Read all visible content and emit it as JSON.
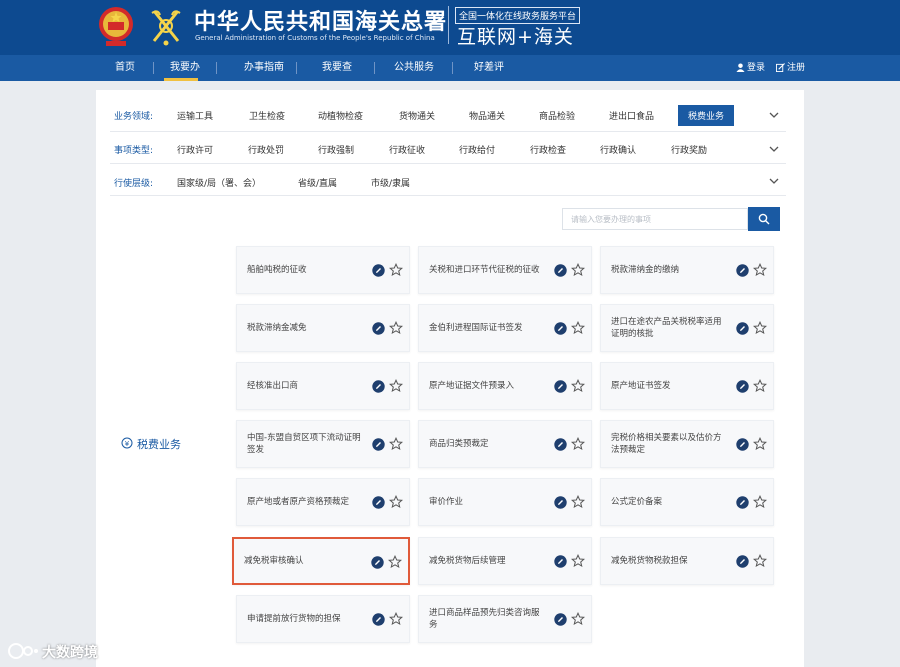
{
  "header": {
    "title": "中华人民共和国海关总署",
    "subtitle": "General Administration of Customs of the People's Republic of China",
    "platform_label": "全国一体化在线政务服务平台",
    "platform_name": "互联网+海关"
  },
  "nav": {
    "items": [
      {
        "label": "首页"
      },
      {
        "label": "我要办"
      },
      {
        "label": "办事指南"
      },
      {
        "label": "我要查"
      },
      {
        "label": "公共服务"
      },
      {
        "label": "好差评"
      }
    ],
    "login": "登录",
    "register": "注册"
  },
  "filters": {
    "domain": {
      "label": "业务领域:",
      "options": [
        "运输工具",
        "卫生检疫",
        "动植物检疫",
        "货物通关",
        "物品通关",
        "商品检验",
        "进出口食品",
        "税费业务"
      ],
      "selected": "税费业务"
    },
    "type": {
      "label": "事项类型:",
      "options": [
        "行政许可",
        "行政处罚",
        "行政强制",
        "行政征收",
        "行政给付",
        "行政检查",
        "行政确认",
        "行政奖励"
      ]
    },
    "level": {
      "label": "行使层级:",
      "options": [
        "国家级/局（署、会）",
        "省级/直属",
        "市级/隶属"
      ]
    }
  },
  "search": {
    "placeholder": "请输入您要办理的事项"
  },
  "category": {
    "label": "税费业务"
  },
  "cards": [
    {
      "title": "船舶吨税的征收"
    },
    {
      "title": "关税和进口环节代征税的征收"
    },
    {
      "title": "税款滞纳金的缴纳"
    },
    {
      "title": "税款滞纳金减免"
    },
    {
      "title": "金伯利进程国际证书签发"
    },
    {
      "title": "进口在途农产品关税税率适用证明的核批"
    },
    {
      "title": "经核准出口商"
    },
    {
      "title": "原产地证据文件预录入"
    },
    {
      "title": "原产地证书签发"
    },
    {
      "title": "中国-东盟自贸区项下流动证明签发"
    },
    {
      "title": "商品归类预裁定"
    },
    {
      "title": "完税价格相关要素以及估价方法预裁定"
    },
    {
      "title": "原产地或者原产资格预裁定"
    },
    {
      "title": "审价作业"
    },
    {
      "title": "公式定价备案"
    },
    {
      "title": "减免税审核确认"
    },
    {
      "title": "减免税货物后续管理"
    },
    {
      "title": "减免税货物税款担保"
    },
    {
      "title": "申请提前放行货物的担保"
    },
    {
      "title": "进口商品样品预先归类咨询服务"
    }
  ],
  "watermark": {
    "text": "大数跨境"
  },
  "colors": {
    "brand_blue": "#0d4a90",
    "nav_blue": "#1a5aa3",
    "highlight": "#e05a3a",
    "accent_gold": "#f0c040"
  }
}
